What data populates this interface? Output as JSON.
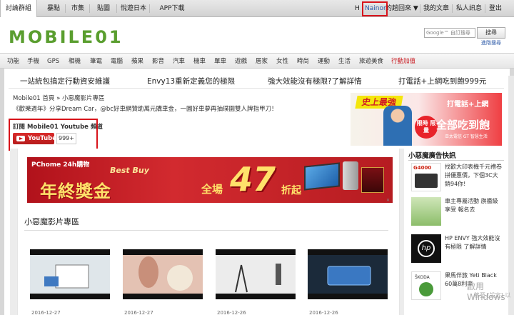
{
  "topnav": {
    "tabs": [
      "討論群組",
      "暴點",
      "市集",
      "貼圖",
      "悅遊日本",
      "APP下載"
    ],
    "user": "Nainor",
    "user_menu": "的趟回來 ▼",
    "links": [
      "我的文章",
      "私人訊息",
      "登出"
    ],
    "h_label": "H"
  },
  "header": {
    "logo_text": "MOBILE01",
    "search_placeholder": "Google™ 自訂搜尋",
    "search_button": "搜尋",
    "advanced_search": "進階搜尋"
  },
  "categories": [
    "功能",
    "手機",
    "GPS",
    "相機",
    "筆電",
    "電腦",
    "蘋果",
    "影音",
    "汽車",
    "機車",
    "單車",
    "遊戲",
    "居家",
    "女性",
    "時尚",
    "運動",
    "生活",
    "旅遊美食",
    "行動加值"
  ],
  "promos": [
    "一站統包搞定行動資安維護",
    "Envy13重新定義您的極限",
    "強大效能沒有極限?了解詳情",
    "打電話+上網吃到飽999元"
  ],
  "breadcrumb": "Mobile01 首頁 » 小惡魔影片專區",
  "marquee": "《歡樂週年》分享Dream Car，@bc好車網贊助萬元購車金，一圓好車夢再抽璞園雙人牌指甲刀！",
  "subscribe": {
    "label": "訂閱 Mobile01 Youtube 頻道",
    "button": "YouTube",
    "count": "999+"
  },
  "right_ad": {
    "tag": "史上最強",
    "line1": "打電話+上網",
    "line2": "全部吃到飽",
    "badge": "限時 限量",
    "small": "亞太電信 GT 智慧生活"
  },
  "banner": {
    "brand": "PChome 24h購物",
    "best_buy": "Best Buy",
    "headline": "年終獎金",
    "quanchang": "全場",
    "number": "47",
    "zhe": "折起",
    "close": "✕"
  },
  "section": {
    "title": "小惡魔影片專區",
    "dates": [
      "2016-12-27",
      "2016-12-27",
      "2016-12-26",
      "2016-12-26"
    ]
  },
  "sidebar": {
    "title": "小惡魔廣告快訊",
    "items": [
      {
        "label": "G4000",
        "text": "找歡大印表機千元禮卷拼優惠價，下個3C大銷94你!"
      },
      {
        "label": "",
        "text": "車主專屬活動 旗艦級享受 報名去"
      },
      {
        "label": "hp",
        "text": "HP ENVY 強大效能沒有極限 了解詳情"
      },
      {
        "label": "ŠKODA",
        "text": "果馬伴旅 Yeti Black 60萬8利率"
      }
    ]
  },
  "watermark": {
    "line1": "啟用 Windows",
    "line2": "移至 [設定] 以"
  }
}
